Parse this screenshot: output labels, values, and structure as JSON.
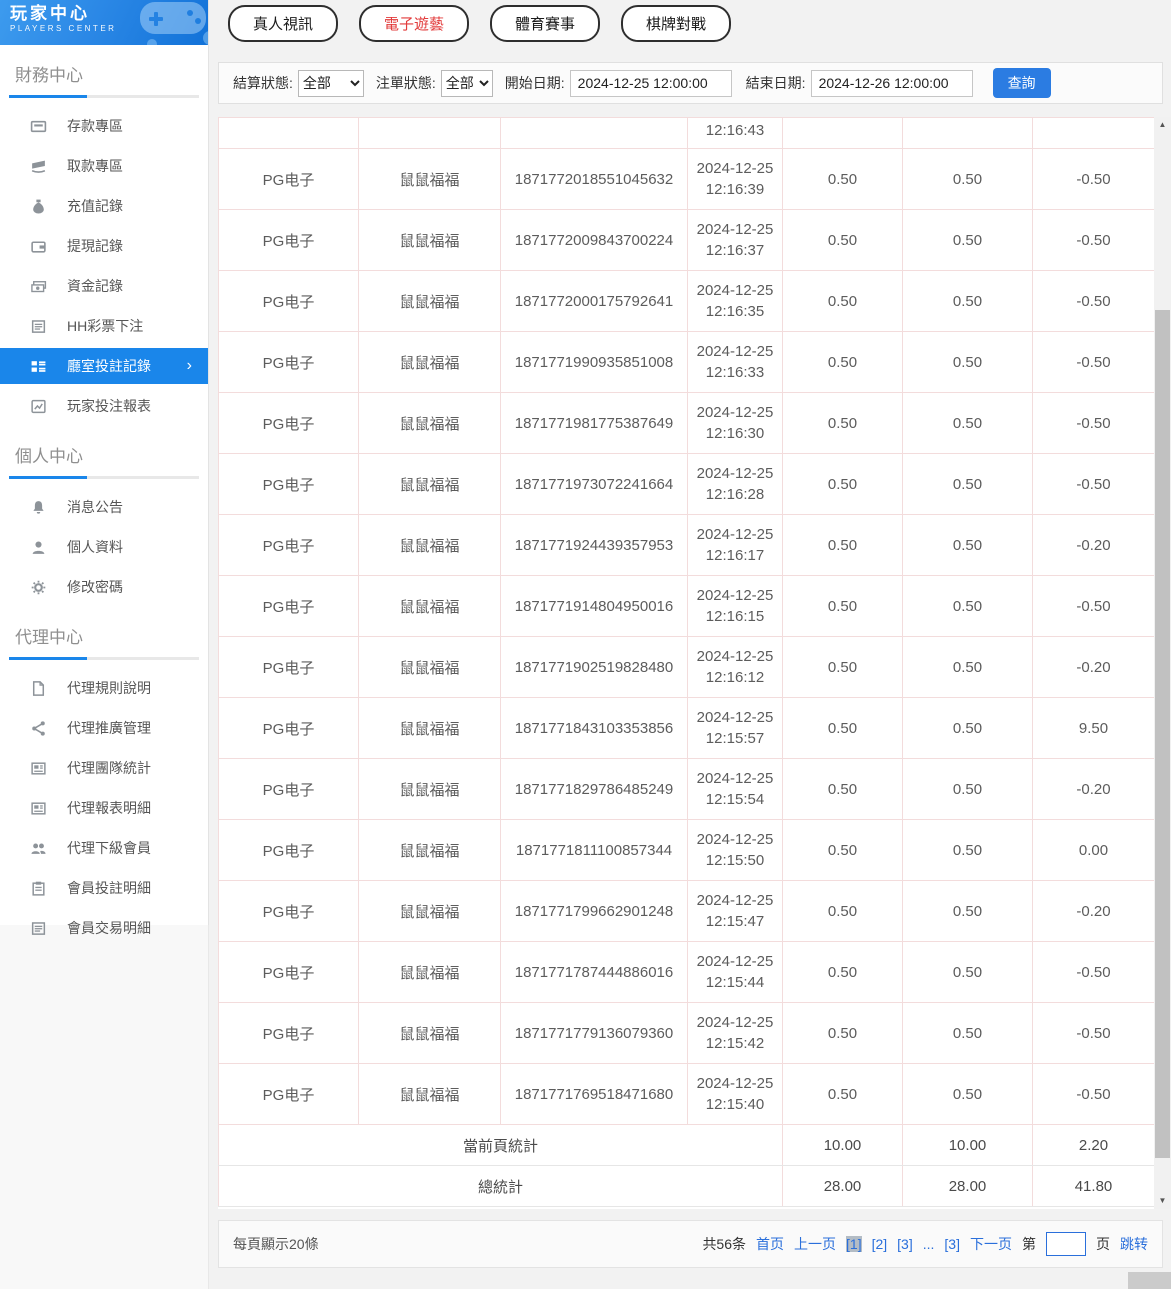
{
  "app": {
    "title": "玩家中心",
    "subtitle": "PLAYERS CENTER"
  },
  "sidebar": {
    "sections": [
      {
        "title": "財務中心",
        "items": [
          {
            "id": "deposit",
            "label": "存款專區",
            "icon": "deposit-icon"
          },
          {
            "id": "withdraw",
            "label": "取款專區",
            "icon": "withdraw-icon"
          },
          {
            "id": "recharge-record",
            "label": "充值記錄",
            "icon": "recharge-icon"
          },
          {
            "id": "withdrawal-record",
            "label": "提現記錄",
            "icon": "wallet-icon"
          },
          {
            "id": "funds-record",
            "label": "資金記錄",
            "icon": "cash-icon"
          },
          {
            "id": "hh-lottery",
            "label": "HH彩票下注",
            "icon": "document-lines-icon"
          },
          {
            "id": "hall-bet-records",
            "label": "廳室投註記錄",
            "icon": "list-board-icon",
            "active": true
          },
          {
            "id": "player-bet-report",
            "label": "玩家投注報表",
            "icon": "chart-icon"
          }
        ]
      },
      {
        "title": "個人中心",
        "items": [
          {
            "id": "announcements",
            "label": "消息公告",
            "icon": "bell-icon"
          },
          {
            "id": "profile",
            "label": "個人資料",
            "icon": "person-icon"
          },
          {
            "id": "change-password",
            "label": "修改密碼",
            "icon": "gear-icon"
          }
        ]
      },
      {
        "title": "代理中心",
        "items": [
          {
            "id": "agent-rules",
            "label": "代理規則說明",
            "icon": "file-icon"
          },
          {
            "id": "agent-promotion",
            "label": "代理推廣管理",
            "icon": "share-icon"
          },
          {
            "id": "agent-team-stats",
            "label": "代理團隊統計",
            "icon": "newspaper-icon"
          },
          {
            "id": "agent-report-detail",
            "label": "代理報表明細",
            "icon": "newspaper-icon"
          },
          {
            "id": "agent-sub-members",
            "label": "代理下級會員",
            "icon": "users-icon"
          },
          {
            "id": "member-bet-detail",
            "label": "會員投註明細",
            "icon": "clipboard-icon"
          },
          {
            "id": "member-transaction-detail",
            "label": "會員交易明細",
            "icon": "document-lines-icon"
          }
        ]
      }
    ]
  },
  "tabs": [
    {
      "id": "live-video",
      "label": "真人視訊",
      "active": false
    },
    {
      "id": "electronic-games",
      "label": "電子遊藝",
      "active": true
    },
    {
      "id": "sports",
      "label": "體育賽事",
      "active": false
    },
    {
      "id": "board-games",
      "label": "棋牌對戰",
      "active": false
    }
  ],
  "filters": {
    "settle_label": "結算狀態:",
    "settle_value": "全部",
    "order_label": "注單狀態:",
    "order_value": "全部",
    "start_label": "開始日期:",
    "start_value": "2024-12-25 12:00:00",
    "end_label": "結束日期:",
    "end_value": "2024-12-26 12:00:00",
    "search_label": "查詢"
  },
  "table": {
    "partial_row_time": "12:16:43",
    "rows": [
      {
        "platform": "PG电子",
        "game": "鼠鼠福福",
        "order_id": "1871772018551045632",
        "date": "2024-12-25",
        "time": "12:16:39",
        "bet": "0.50",
        "valid": "0.50",
        "win": "-0.50"
      },
      {
        "platform": "PG电子",
        "game": "鼠鼠福福",
        "order_id": "1871772009843700224",
        "date": "2024-12-25",
        "time": "12:16:37",
        "bet": "0.50",
        "valid": "0.50",
        "win": "-0.50"
      },
      {
        "platform": "PG电子",
        "game": "鼠鼠福福",
        "order_id": "1871772000175792641",
        "date": "2024-12-25",
        "time": "12:16:35",
        "bet": "0.50",
        "valid": "0.50",
        "win": "-0.50"
      },
      {
        "platform": "PG电子",
        "game": "鼠鼠福福",
        "order_id": "1871771990935851008",
        "date": "2024-12-25",
        "time": "12:16:33",
        "bet": "0.50",
        "valid": "0.50",
        "win": "-0.50"
      },
      {
        "platform": "PG电子",
        "game": "鼠鼠福福",
        "order_id": "1871771981775387649",
        "date": "2024-12-25",
        "time": "12:16:30",
        "bet": "0.50",
        "valid": "0.50",
        "win": "-0.50"
      },
      {
        "platform": "PG电子",
        "game": "鼠鼠福福",
        "order_id": "1871771973072241664",
        "date": "2024-12-25",
        "time": "12:16:28",
        "bet": "0.50",
        "valid": "0.50",
        "win": "-0.50"
      },
      {
        "platform": "PG电子",
        "game": "鼠鼠福福",
        "order_id": "1871771924439357953",
        "date": "2024-12-25",
        "time": "12:16:17",
        "bet": "0.50",
        "valid": "0.50",
        "win": "-0.20"
      },
      {
        "platform": "PG电子",
        "game": "鼠鼠福福",
        "order_id": "1871771914804950016",
        "date": "2024-12-25",
        "time": "12:16:15",
        "bet": "0.50",
        "valid": "0.50",
        "win": "-0.50"
      },
      {
        "platform": "PG电子",
        "game": "鼠鼠福福",
        "order_id": "1871771902519828480",
        "date": "2024-12-25",
        "time": "12:16:12",
        "bet": "0.50",
        "valid": "0.50",
        "win": "-0.20"
      },
      {
        "platform": "PG电子",
        "game": "鼠鼠福福",
        "order_id": "1871771843103353856",
        "date": "2024-12-25",
        "time": "12:15:57",
        "bet": "0.50",
        "valid": "0.50",
        "win": "9.50"
      },
      {
        "platform": "PG电子",
        "game": "鼠鼠福福",
        "order_id": "1871771829786485249",
        "date": "2024-12-25",
        "time": "12:15:54",
        "bet": "0.50",
        "valid": "0.50",
        "win": "-0.20"
      },
      {
        "platform": "PG电子",
        "game": "鼠鼠福福",
        "order_id": "1871771811100857344",
        "date": "2024-12-25",
        "time": "12:15:50",
        "bet": "0.50",
        "valid": "0.50",
        "win": "0.00"
      },
      {
        "platform": "PG电子",
        "game": "鼠鼠福福",
        "order_id": "1871771799662901248",
        "date": "2024-12-25",
        "time": "12:15:47",
        "bet": "0.50",
        "valid": "0.50",
        "win": "-0.20"
      },
      {
        "platform": "PG电子",
        "game": "鼠鼠福福",
        "order_id": "1871771787444886016",
        "date": "2024-12-25",
        "time": "12:15:44",
        "bet": "0.50",
        "valid": "0.50",
        "win": "-0.50"
      },
      {
        "platform": "PG电子",
        "game": "鼠鼠福福",
        "order_id": "1871771779136079360",
        "date": "2024-12-25",
        "time": "12:15:42",
        "bet": "0.50",
        "valid": "0.50",
        "win": "-0.50"
      },
      {
        "platform": "PG电子",
        "game": "鼠鼠福福",
        "order_id": "1871771769518471680",
        "date": "2024-12-25",
        "time": "12:15:40",
        "bet": "0.50",
        "valid": "0.50",
        "win": "-0.50"
      }
    ],
    "page_summary": {
      "label": "當前頁統計",
      "bet": "10.00",
      "valid": "10.00",
      "win": "2.20"
    },
    "total_summary": {
      "label": "總統計",
      "bet": "28.00",
      "valid": "28.00",
      "win": "41.80"
    }
  },
  "footer": {
    "per_page": "每頁顯示20條",
    "total": "共56条",
    "first": "首页",
    "prev": "上一页",
    "pages": [
      "[1]",
      "[2]",
      "[3]",
      "...",
      "[3]"
    ],
    "current_index": 0,
    "next": "下一页",
    "jump_prefix": "第",
    "jump_suffix": "页",
    "jump_label": "跳转",
    "jump_value": ""
  },
  "colors": {
    "accent_blue": "#1a86ea",
    "button_blue": "#2b7ce2",
    "active_tab_red": "#e23b3b",
    "table_border_pink": "#f3dcdc",
    "link_blue": "#2a6fdb"
  }
}
